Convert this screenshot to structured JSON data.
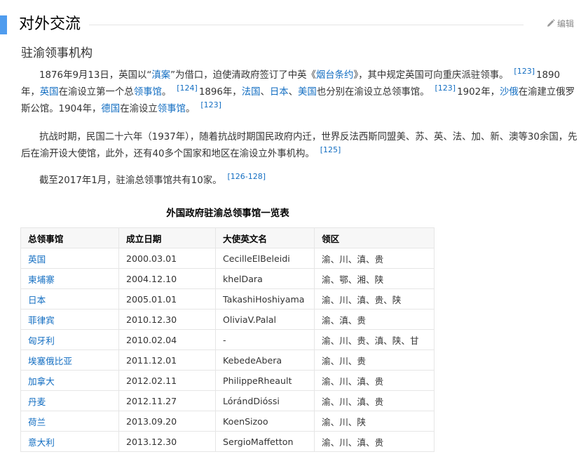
{
  "section": {
    "title": "对外交流",
    "edit_label": "编辑"
  },
  "subsection": {
    "title": "驻渝领事机构"
  },
  "paragraphs": {
    "p1": {
      "t1": "1876年9月13日，英国以“",
      "l1": "滇案",
      "t2": "”为借口，迫使清政府签订了中英《",
      "l2": "烟台条约",
      "t3": "》，其中规定英国可向重庆派驻领事。",
      "r1": "[123]",
      "t4": "1890年，",
      "l3": "英国",
      "t5": "在渝设立第一个总",
      "l4": "领事馆",
      "t6": "。",
      "r2": "[124]",
      "t7": "1896年，",
      "l5": "法国",
      "t8": "、",
      "l6": "日本",
      "t9": "、",
      "l7": "美国",
      "t10": "也分别在渝设立总领事馆。",
      "r3": "[123]",
      "t11": "1902年，",
      "l8": "沙俄",
      "t12": "在渝建立俄罗斯公馆。1904年，",
      "l9": "德国",
      "t13": "在渝设立",
      "l10": "领事馆",
      "t14": "。",
      "r4": "[123]"
    },
    "p2": {
      "t1": "抗战时期，民国二十六年（1937年），随着抗战时期国民政府内迁，世界反法西斯同盟美、苏、英、法、加、新、澳等30余国，先后在渝开设大使馆，此外，还有40多个国家和地区在渝设立外事机构。",
      "r1": "[125]"
    },
    "p3": {
      "t1": "截至2017年1月，驻渝总领事馆共有10家。",
      "r1": "[126-128]"
    }
  },
  "table": {
    "caption": "外国政府驻渝总领事馆一览表",
    "headers": [
      "总领事馆",
      "成立日期",
      "大使英文名",
      "领区"
    ],
    "rows": [
      [
        "英国",
        "2000.03.01",
        "CecilleElBeleidi",
        "渝、川、滇、贵"
      ],
      [
        "柬埔寨",
        "2004.12.10",
        "khelDara",
        "渝、鄂、湘、陕"
      ],
      [
        "日本",
        "2005.01.01",
        "TakashiHoshiyama",
        "渝、川、滇、贵、陕"
      ],
      [
        "菲律宾",
        "2010.12.30",
        "OliviaV.Palal",
        "渝、滇、贵"
      ],
      [
        "匈牙利",
        "2010.02.04",
        "-",
        "渝、川、贵、滇、陕、甘"
      ],
      [
        "埃塞俄比亚",
        "2011.12.01",
        "KebedeAbera",
        "渝、川、贵"
      ],
      [
        "加拿大",
        "2012.02.11",
        "PhilippeRheault",
        "渝、川、滇、贵"
      ],
      [
        "丹麦",
        "2012.11.27",
        "LórándDióssi",
        "渝、川、滇、贵"
      ],
      [
        "荷兰",
        "2013.09.20",
        "KoenSizoo",
        "渝、川、陕"
      ],
      [
        "意大利",
        "2013.12.30",
        "SergioMaffetton",
        "渝、川、滇、贵"
      ]
    ]
  },
  "colors": {
    "accent": "#4f9cee",
    "link": "#136ec2",
    "text": "#333333"
  },
  "icons": {
    "edit": "pencil-icon"
  }
}
